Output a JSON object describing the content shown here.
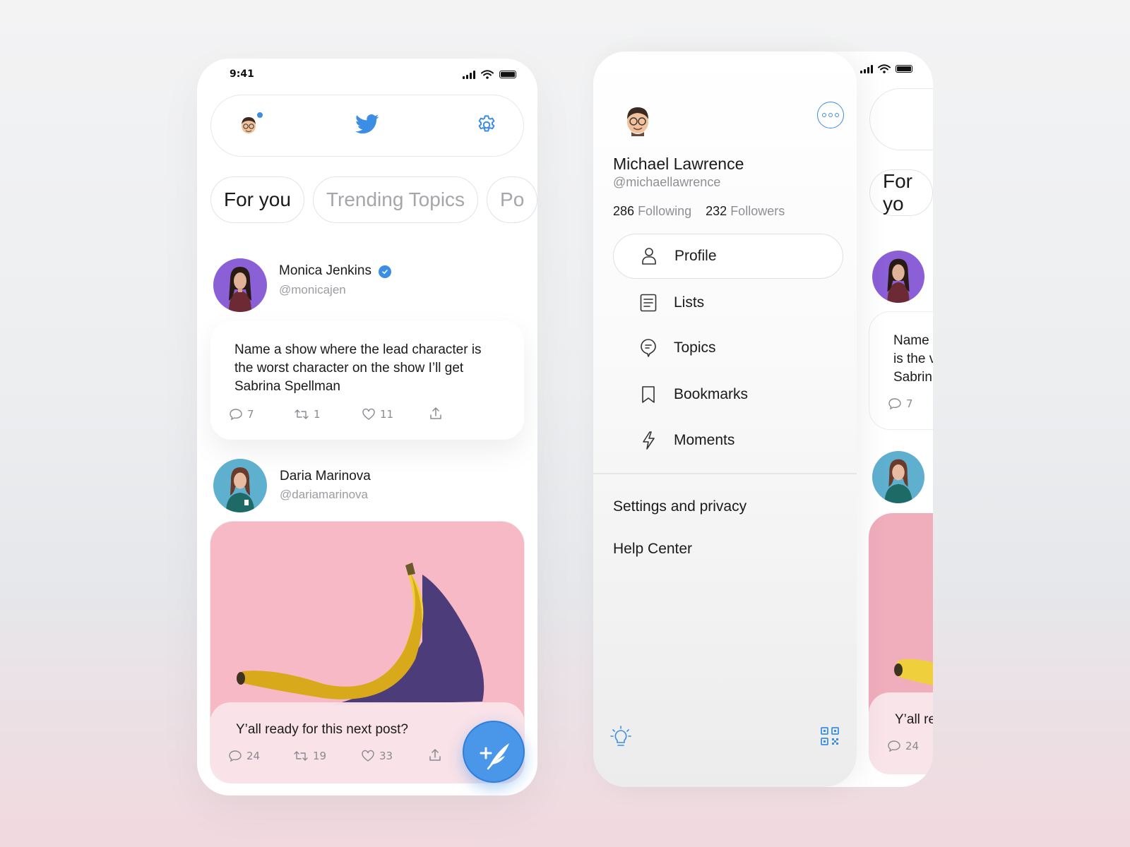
{
  "status": {
    "time": "9:41"
  },
  "feed": {
    "tabs": [
      {
        "label": "For you"
      },
      {
        "label": "Trending Topics"
      },
      {
        "label": "Po"
      }
    ],
    "tweets": [
      {
        "name": "Monica Jenkins",
        "handle": "@monicajen",
        "text": "Name a show where the lead character is the worst character on the show I’ll get Sabrina Spellman",
        "replies": "7",
        "retweets": "1",
        "likes": "11"
      },
      {
        "name": "Daria Marinova",
        "handle": "@dariamarinova",
        "text": "Y’all ready for this next post?",
        "replies": "24",
        "retweets": "19",
        "likes": "33"
      }
    ]
  },
  "drawer": {
    "name": "Michael Lawrence",
    "handle": "@michaellawrence",
    "following_count": "286",
    "following_label": "Following",
    "followers_count": "232",
    "followers_label": "Followers",
    "menu": [
      {
        "label": "Profile",
        "icon": "person-icon"
      },
      {
        "label": "Lists",
        "icon": "list-icon"
      },
      {
        "label": "Topics",
        "icon": "topics-icon"
      },
      {
        "label": "Bookmarks",
        "icon": "bookmark-icon"
      },
      {
        "label": "Moments",
        "icon": "lightning-icon"
      }
    ],
    "settings_label": "Settings and privacy",
    "help_label": "Help Center"
  },
  "peek": {
    "tab": "For yo",
    "text_lines": [
      "Name",
      "is the v",
      "Sabrin"
    ],
    "replies_1": "7",
    "text2": "Y’all re",
    "replies_2": "24"
  },
  "colors": {
    "accent": "#3b8ee3",
    "avatar_purple": "#8b5fd6",
    "avatar_teal": "#5fb0cf",
    "media_pink": "#f6b9c5"
  }
}
